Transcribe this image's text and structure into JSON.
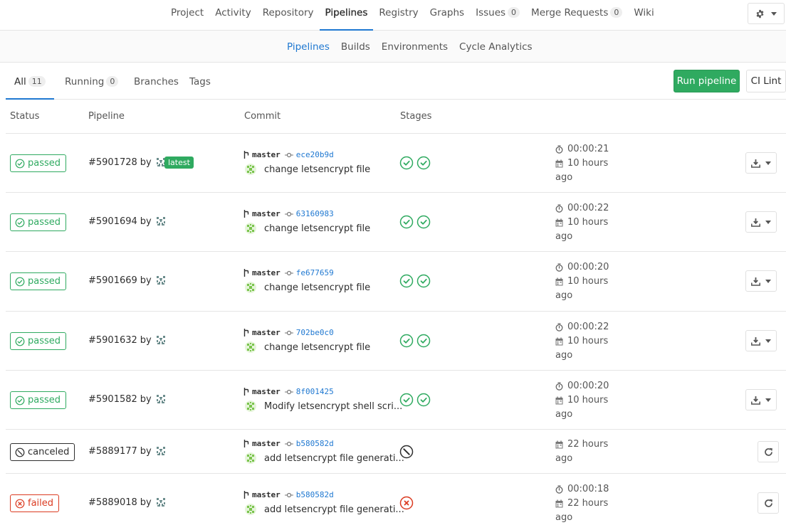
{
  "topnav": {
    "items": [
      {
        "label": "Project"
      },
      {
        "label": "Activity"
      },
      {
        "label": "Repository"
      },
      {
        "label": "Pipelines"
      },
      {
        "label": "Registry"
      },
      {
        "label": "Graphs"
      },
      {
        "label": "Issues",
        "count": "0"
      },
      {
        "label": "Merge Requests",
        "count": "0"
      },
      {
        "label": "Wiki"
      }
    ],
    "active": "Pipelines"
  },
  "subnav": {
    "items": [
      {
        "label": "Pipelines"
      },
      {
        "label": "Builds"
      },
      {
        "label": "Environments"
      },
      {
        "label": "Cycle Analytics"
      }
    ],
    "active": "Pipelines"
  },
  "tabs": {
    "all": {
      "label": "All",
      "count": "11"
    },
    "running": {
      "label": "Running",
      "count": "0"
    },
    "branches": {
      "label": "Branches"
    },
    "tags": {
      "label": "Tags"
    }
  },
  "actions": {
    "run_pipeline": "Run pipeline",
    "ci_lint": "CI Lint"
  },
  "table": {
    "headers": {
      "status": "Status",
      "pipeline": "Pipeline",
      "commit": "Commit",
      "stages": "Stages"
    },
    "rows": [
      {
        "status": "passed",
        "id": "#5901728",
        "by": "by",
        "latest": "latest",
        "branch": "master",
        "sha": "ece20b9d",
        "title": "change letsencrypt file",
        "duration": "00:00:21",
        "finished": "10 hours",
        "ago": "ago",
        "stages": [
          "success",
          "success"
        ],
        "action": "download"
      },
      {
        "status": "passed",
        "id": "#5901694",
        "by": "by",
        "branch": "master",
        "sha": "63160983",
        "title": "change letsencrypt file",
        "duration": "00:00:22",
        "finished": "10 hours",
        "ago": "ago",
        "stages": [
          "success",
          "success"
        ],
        "action": "download"
      },
      {
        "status": "passed",
        "id": "#5901669",
        "by": "by",
        "branch": "master",
        "sha": "fe677659",
        "title": "change letsencrypt file",
        "duration": "00:00:20",
        "finished": "10 hours",
        "ago": "ago",
        "stages": [
          "success",
          "success"
        ],
        "action": "download"
      },
      {
        "status": "passed",
        "id": "#5901632",
        "by": "by",
        "branch": "master",
        "sha": "702be0c0",
        "title": "change letsencrypt file",
        "duration": "00:00:22",
        "finished": "10 hours",
        "ago": "ago",
        "stages": [
          "success",
          "success"
        ],
        "action": "download"
      },
      {
        "status": "passed",
        "id": "#5901582",
        "by": "by",
        "branch": "master",
        "sha": "8f001425",
        "title": "Modify letsencrypt shell scri...",
        "duration": "00:00:20",
        "finished": "10 hours",
        "ago": "ago",
        "stages": [
          "success",
          "success"
        ],
        "action": "download"
      },
      {
        "status": "canceled",
        "id": "#5889177",
        "by": "by",
        "branch": "master",
        "sha": "b580582d",
        "title": "add letsencrypt file generati...",
        "finished": "22 hours",
        "ago": "ago",
        "stages": [
          "canceled"
        ],
        "action": "retry"
      },
      {
        "status": "failed",
        "id": "#5889018",
        "by": "by",
        "branch": "master",
        "sha": "b580582d",
        "title": "add letsencrypt file generati...",
        "duration": "00:00:18",
        "finished": "22 hours",
        "ago": "ago",
        "stages": [
          "failed"
        ],
        "action": "retry"
      }
    ]
  },
  "colors": {
    "success": "#2faa60",
    "failed": "#db3b21",
    "canceled": "#2e2e2e",
    "link": "#1f78d1"
  }
}
